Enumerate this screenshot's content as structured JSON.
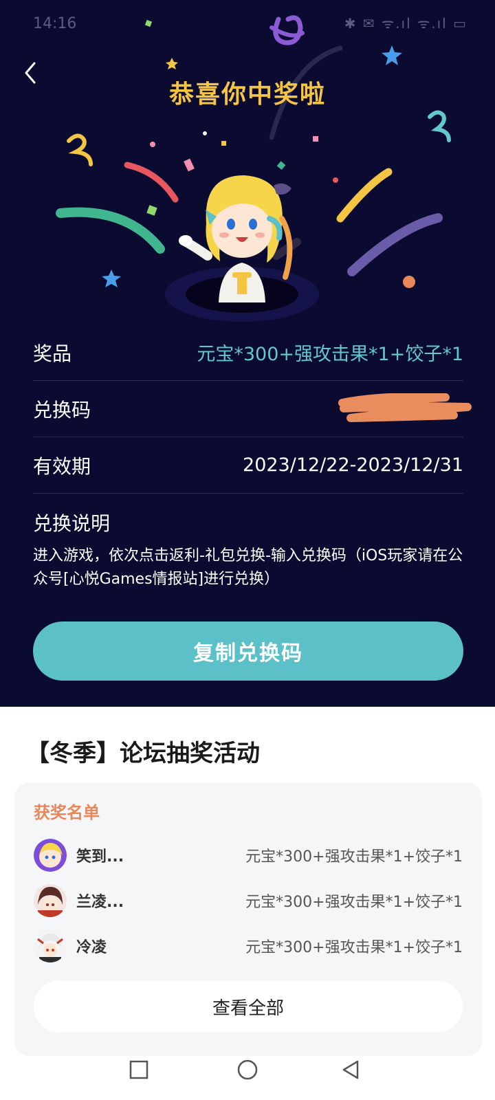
{
  "status_bar": {
    "time": "14:16",
    "icons": "✱ ✉ ᯤ.ıl ᯤ.ıl ▭"
  },
  "header": {
    "title": "恭喜你中奖啦"
  },
  "prize_info": {
    "prize_label": "奖品",
    "prize_value": "元宝*300+强攻击果*1+饺子*1",
    "code_label": "兑换码",
    "validity_label": "有效期",
    "validity_value": "2023/12/22-2023/12/31"
  },
  "instructions": {
    "title": "兑换说明",
    "text": "进入游戏，依次点击返利-礼包兑换-输入兑换码（iOS玩家请在公众号[心悦Games情报站]进行兑换）"
  },
  "copy_button": {
    "label": "复制兑换码"
  },
  "event": {
    "title": "【冬季】论坛抽奖活动",
    "winners_title": "获奖名单",
    "winners": [
      {
        "name": "笑到...",
        "prize": "元宝*300+强攻击果*1+饺子*1"
      },
      {
        "name": "兰凌...",
        "prize": "元宝*300+强攻击果*1+饺子*1"
      },
      {
        "name": "冷凌",
        "prize": "元宝*300+强攻击果*1+饺子*1"
      }
    ],
    "view_all_label": "查看全部"
  },
  "colors": {
    "background_dark": "#0b0a30",
    "title_gold": "#f4c542",
    "accent_teal": "#5bc0c8",
    "prize_teal": "#62c7cf",
    "winners_orange": "#e8875a"
  },
  "icons": {
    "back": "chevron-left-icon",
    "nav_recent": "square-icon",
    "nav_home": "circle-icon",
    "nav_back": "triangle-back-icon"
  }
}
